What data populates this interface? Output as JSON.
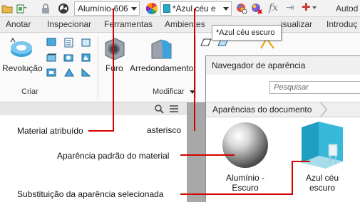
{
  "toolbar": {
    "material_dropdown": "Alumínio-606",
    "appearance_dropdown": "*Azul céu e",
    "app_name": "Autod",
    "icons": [
      "folder-icon",
      "lock-icon",
      "radioactive-icon",
      "color-wheel-icon",
      "appearance-swatch-icon",
      "adjust-appearance-icon",
      "clear-appearance-icon",
      "fx-icon",
      "arrow-icon",
      "plus-icon"
    ]
  },
  "tabs": [
    "Anotar",
    "Inspecionar",
    "Ferramentas",
    "Ambientes",
    "isualizar",
    "Introduç"
  ],
  "ribbon": {
    "revolucao": "Revolução",
    "furo": "Furo",
    "arredondamento": "Arredondamento",
    "criar": "Criar",
    "modificar": "Modificar"
  },
  "tooltip": "*Azul céu escuro",
  "browser": {
    "title": "Navegador de aparência",
    "search_placeholder": "Pesquisar",
    "breadcrumb": "Aparências do documento",
    "swatches": [
      {
        "line1": "Alumínio -",
        "line2": "Escuro"
      },
      {
        "line1": "Azul céu",
        "line2": "escuro"
      }
    ]
  },
  "annotations": {
    "material": "Material atribuído",
    "asterisco": "asterisco",
    "default_appearance": "Aparência padrão do material",
    "override": "Substituição da aparência selecionada"
  },
  "colors": {
    "annotation_line": "#d40000",
    "teal": "#29a9c7"
  }
}
